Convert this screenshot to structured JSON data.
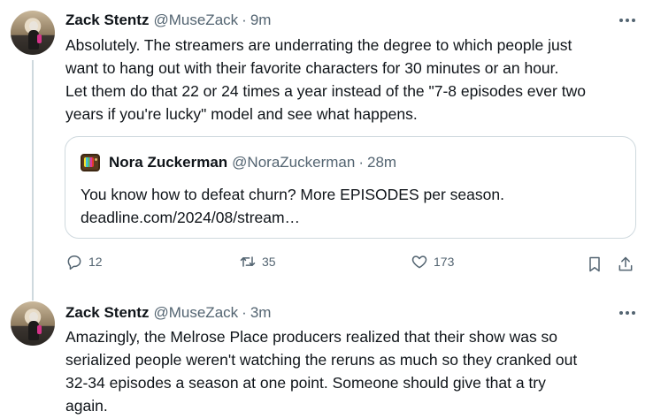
{
  "tweets": [
    {
      "author_name": "Zack Stentz",
      "author_handle": "@MuseZack",
      "separator": "·",
      "time": "9m",
      "text": "Absolutely. The streamers are underrating the degree to which people just\nwant to hang out with their favorite characters for 30 minutes or an hour.\nLet them do that 22 or 24 times a year instead of the \"7-8 episodes ever two\nyears if you're lucky\" model and see what happens.",
      "quote": {
        "author_name": "Nora Zuckerman",
        "author_handle": "@NoraZuckerman",
        "separator": "·",
        "time": "28m",
        "text": "You know how to defeat churn?  More EPISODES per season.\ndeadline.com/2024/08/stream…"
      },
      "actions": {
        "replies": "12",
        "reposts": "35",
        "likes": "173"
      }
    },
    {
      "author_name": "Zack Stentz",
      "author_handle": "@MuseZack",
      "separator": "·",
      "time": "3m",
      "text": "Amazingly, the Melrose Place producers realized that their show was so\nserialized people weren't watching the reruns as much so they cranked out\n32-34 episodes  a season at one point. Someone should give that a try\nagain."
    }
  ],
  "icons": {
    "more": "more-horizontal-icon",
    "reply": "reply-icon",
    "repost": "repost-icon",
    "like": "heart-icon",
    "bookmark": "bookmark-icon",
    "share": "share-icon",
    "quote_avatar": "tv-icon"
  },
  "colors": {
    "text": "#0f1419",
    "secondary": "#536471",
    "border": "#cfd9de"
  }
}
